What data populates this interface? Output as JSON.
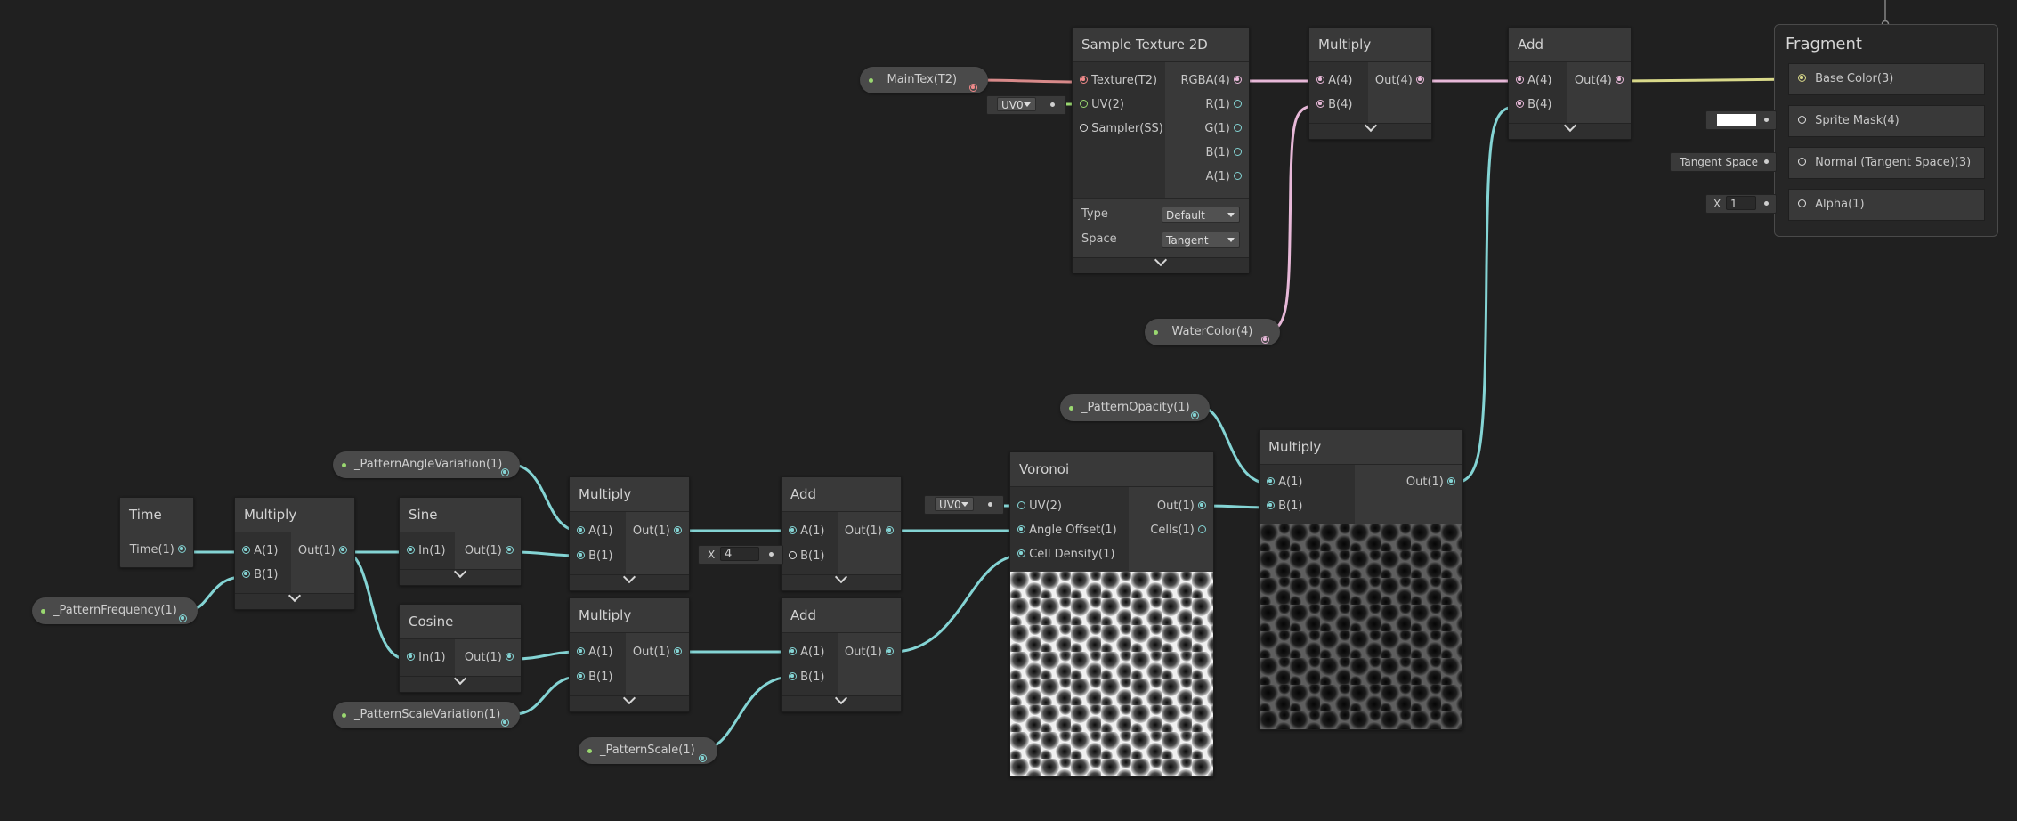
{
  "nodes": {
    "sample_texture": {
      "title": "Sample Texture 2D",
      "inputs": [
        "Texture(T2)",
        "UV(2)",
        "Sampler(SS)"
      ],
      "outputs": [
        "RGBA(4)",
        "R(1)",
        "G(1)",
        "B(1)",
        "A(1)"
      ],
      "type_label": "Type",
      "type_value": "Default",
      "space_label": "Space",
      "space_value": "Tangent",
      "uv_field": "UV0"
    },
    "multiply_top": {
      "title": "Multiply",
      "inputs": [
        "A(4)",
        "B(4)"
      ],
      "output": "Out(4)"
    },
    "add_top": {
      "title": "Add",
      "inputs": [
        "A(4)",
        "B(4)"
      ],
      "output": "Out(4)"
    },
    "time": {
      "title": "Time",
      "output": "Time(1)"
    },
    "multiply_time": {
      "title": "Multiply",
      "inputs": [
        "A(1)",
        "B(1)"
      ],
      "output": "Out(1)"
    },
    "sine": {
      "title": "Sine",
      "input": "In(1)",
      "output": "Out(1)"
    },
    "cosine": {
      "title": "Cosine",
      "input": "In(1)",
      "output": "Out(1)"
    },
    "multiply_sine": {
      "title": "Multiply",
      "inputs": [
        "A(1)",
        "B(1)"
      ],
      "output": "Out(1)"
    },
    "multiply_cosine": {
      "title": "Multiply",
      "inputs": [
        "A(1)",
        "B(1)"
      ],
      "output": "Out(1)"
    },
    "add_sine": {
      "title": "Add",
      "inputs": [
        "A(1)",
        "B(1)"
      ],
      "output": "Out(1)",
      "b_field_label": "X",
      "b_field_value": "4"
    },
    "add_cosine": {
      "title": "Add",
      "inputs": [
        "A(1)",
        "B(1)"
      ],
      "output": "Out(1)"
    },
    "voronoi": {
      "title": "Voronoi",
      "inputs": [
        "UV(2)",
        "Angle Offset(1)",
        "Cell Density(1)"
      ],
      "outputs": [
        "Out(1)",
        "Cells(1)"
      ],
      "uv_field": "UV0"
    },
    "multiply_opacity": {
      "title": "Multiply",
      "inputs": [
        "A(1)",
        "B(1)"
      ],
      "output": "Out(1)"
    }
  },
  "properties": {
    "main_tex": "_MainTex(T2)",
    "water_color": "_WaterColor(4)",
    "pattern_opacity": "_PatternOpacity(1)",
    "pattern_angle_variation": "_PatternAngleVariation(1)",
    "pattern_frequency": "_PatternFrequency(1)",
    "pattern_scale_variation": "_PatternScaleVariation(1)",
    "pattern_scale": "_PatternScale(1)"
  },
  "fragment": {
    "title": "Fragment",
    "ports": [
      "Base Color(3)",
      "Sprite Mask(4)",
      "Normal (Tangent Space)(3)",
      "Alpha(1)"
    ],
    "normal_field": "Tangent Space",
    "alpha_label": "X",
    "alpha_value": "1"
  },
  "colors": {
    "background": "#202020",
    "node": "#393939",
    "wire_float": "#84d4d4",
    "wire_vector4": "#e7b8d8",
    "wire_texture": "#f08a8a",
    "wire_vector3": "#d9d98a",
    "property_dot": "#9ad870"
  }
}
